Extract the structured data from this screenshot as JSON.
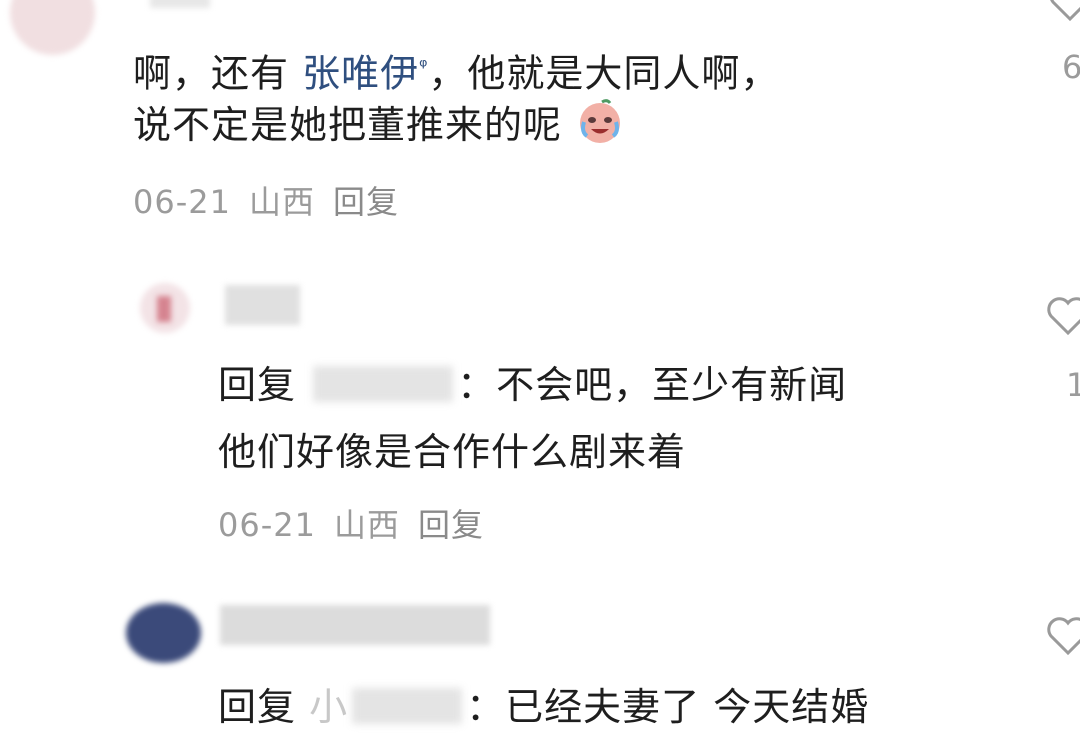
{
  "comment1": {
    "text_part1": "啊，还有 ",
    "mention": "张唯伊",
    "search_mark": "ᵠ",
    "text_part2": "，他就是大同人啊，",
    "text_line2": "说不定是她把董推来的呢",
    "emoji": "crying-laughing-emoji",
    "date": "06-21",
    "location": "山西",
    "reply_label": "回复",
    "like_count": "6"
  },
  "comment2": {
    "reply_prefix": "回复",
    "colon": "：",
    "text_line1": "不会吧，至少有新闻",
    "text_line2": "他们好像是合作什么剧来着",
    "date": "06-21",
    "location": "山西",
    "reply_label": "回复",
    "like_count": "1"
  },
  "comment3": {
    "reply_prefix": "回复",
    "name_fragment": "小",
    "colon": "：",
    "text_line1": "已经夫妻了 今天结婚"
  },
  "colors": {
    "text": "#1e1e1e",
    "meta": "#9b9b9b",
    "mention": "#2f4f7f",
    "icon": "#9a9a9a"
  }
}
